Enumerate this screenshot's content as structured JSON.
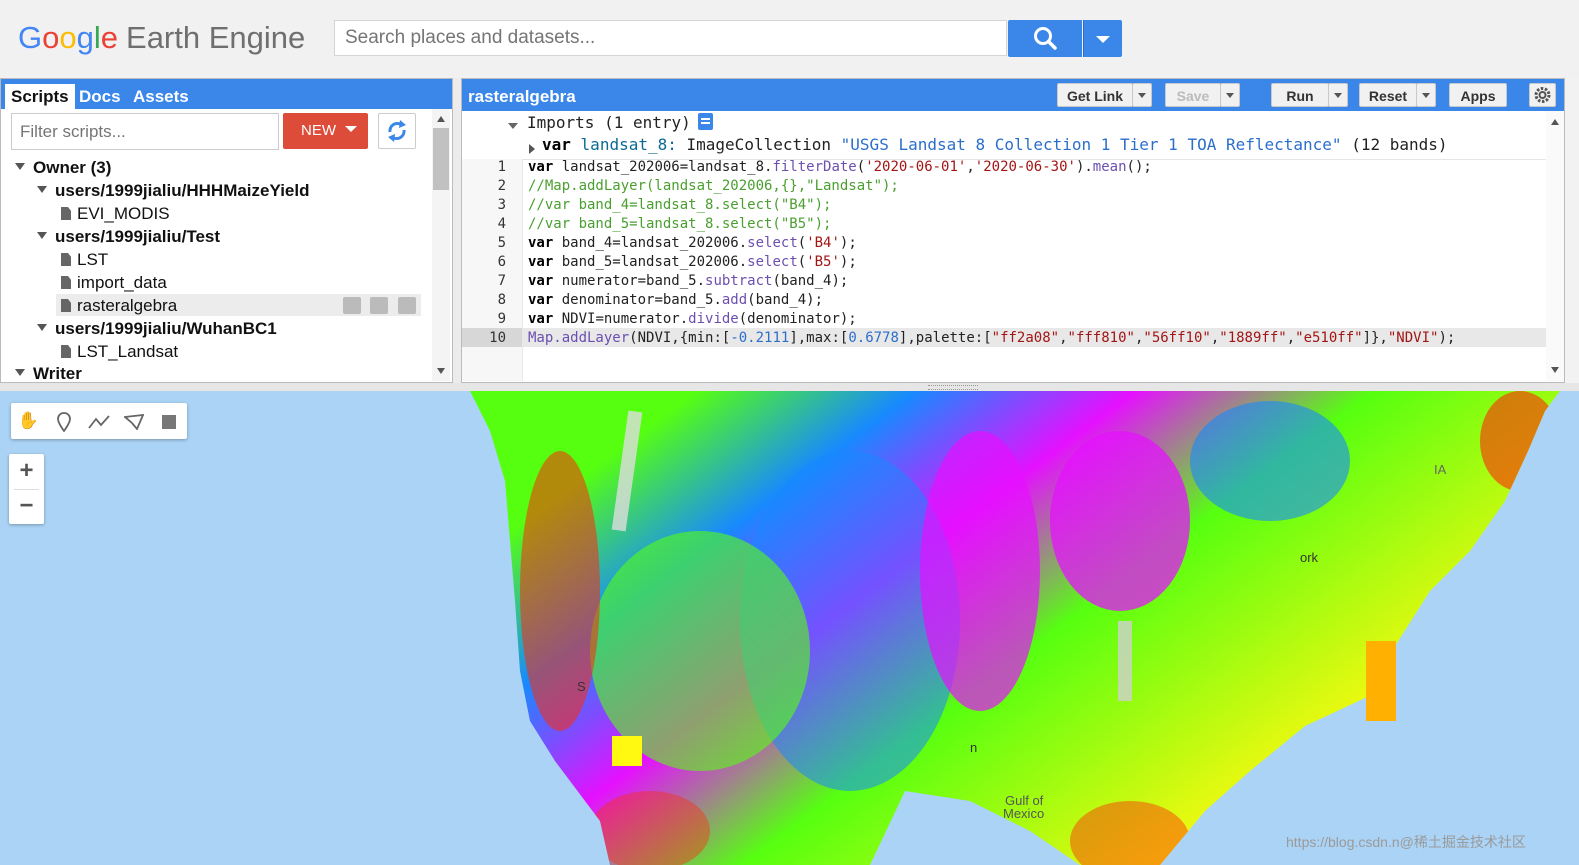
{
  "header": {
    "logo_google": [
      "G",
      "o",
      "o",
      "g",
      "l",
      "e"
    ],
    "logo_product": "Earth Engine",
    "search_placeholder": "Search places and datasets..."
  },
  "left_panel": {
    "tabs": [
      "Scripts",
      "Docs",
      "Assets"
    ],
    "filter_placeholder": "Filter scripts...",
    "new_label": "NEW",
    "tree": {
      "owner": "Owner (3)",
      "repo1": "users/1999jialiu/HHHMaizeYield",
      "repo1_files": [
        "EVI_MODIS"
      ],
      "repo2": "users/1999jialiu/Test",
      "repo2_files": [
        "LST",
        "import_data",
        "rasteralgebra"
      ],
      "repo3": "users/1999jialiu/WuhanBC1",
      "repo3_files": [
        "LST_Landsat"
      ],
      "writer": "Writer"
    }
  },
  "editor": {
    "title": "rasteralgebra",
    "buttons": {
      "get_link": "Get Link",
      "save": "Save",
      "run": "Run",
      "reset": "Reset",
      "apps": "Apps"
    },
    "imports_line": "Imports (1 entry)",
    "import_var": {
      "kw": "var",
      "name": "landsat_8:",
      "type": "ImageCollection",
      "string": "\"USGS Landsat 8 Collection 1 Tier 1 TOA Reflectance\"",
      "bands": "(12 bands)"
    },
    "line_numbers": [
      "1",
      "2",
      "3",
      "4",
      "5",
      "6",
      "7",
      "8",
      "9",
      "10"
    ],
    "code": {
      "l1": {
        "kw": "var",
        "a": " landsat_202006=landsat_8.",
        "fn": "filterDate",
        "b": "(",
        "s1": "'2020-06-01'",
        "c": ",",
        "s2": "'2020-06-30'",
        "d": ").",
        "fn2": "mean",
        "e": "();"
      },
      "l2": "//Map.addLayer(landsat_202006,{},\"Landsat\");",
      "l3": "//var band_4=landsat_8.select(\"B4\");",
      "l4": "//var band_5=landsat_8.select(\"B5\");",
      "l5": {
        "kw": "var",
        "a": " band_4=landsat_202006.",
        "fn": "select",
        "b": "(",
        "s": "'B4'",
        "c": ");"
      },
      "l6": {
        "kw": "var",
        "a": " band_5=landsat_202006.",
        "fn": "select",
        "b": "(",
        "s": "'B5'",
        "c": ");"
      },
      "l7": {
        "kw": "var",
        "a": " numerator=band_5.",
        "fn": "subtract",
        "b": "(band_4);"
      },
      "l8": {
        "kw": "var",
        "a": " denominator=band_5.",
        "fn": "add",
        "b": "(band_4);"
      },
      "l9": {
        "kw": "var",
        "a": " NDVI=numerator.",
        "fn": "divide",
        "b": "(denominator);"
      },
      "l10": {
        "fn": "Map.addLayer",
        "a": "(NDVI,{min:[",
        "n1": "-0.2111",
        "b": "],max:[",
        "n2": "0.6778",
        "c": "],palette:[",
        "s1": "\"ff2a08\"",
        "s2": "\"fff810\"",
        "s3": "\"56ff10\"",
        "s4": "\"1889ff\"",
        "s5": "\"e510ff\"",
        "d": "]},",
        "s6": "\"NDVI\"",
        "e": ");"
      }
    }
  },
  "map": {
    "zoom_in": "+",
    "zoom_out": "−",
    "labels": {
      "gulf1": "Gulf of",
      "gulf2": "Mexico",
      "york": "ork",
      "ia": "IA",
      "n": "n",
      "s": "S"
    },
    "palette": [
      "#ff2a08",
      "#fff810",
      "#56ff10",
      "#1889ff",
      "#e510ff"
    ],
    "watermark": "https://blog.csdn.n@稀土掘金技术社区"
  }
}
